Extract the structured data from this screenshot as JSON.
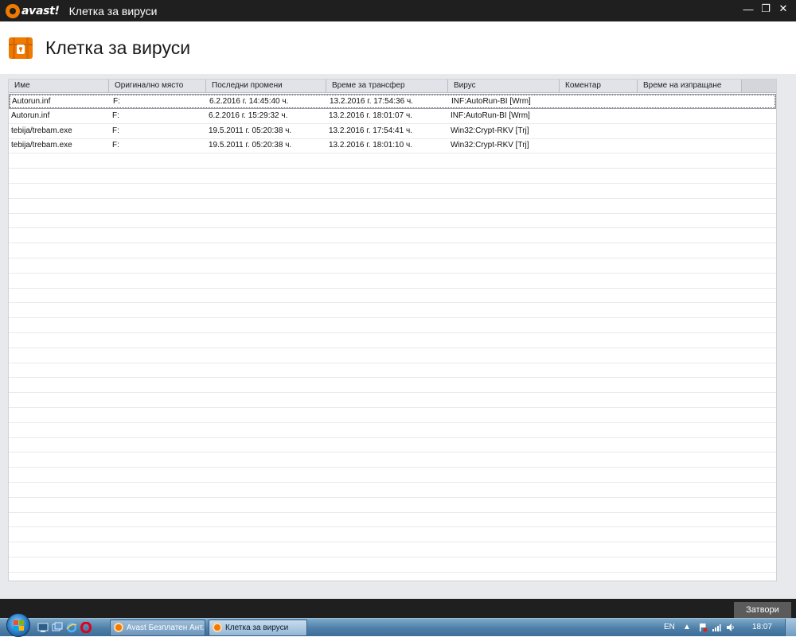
{
  "window": {
    "logo_text": "avast!",
    "title": "Клетка за вируси",
    "controls": {
      "minimize": "—",
      "restore": "❐",
      "close": "✕"
    }
  },
  "header": {
    "title": "Клетка за вируси"
  },
  "table": {
    "columns": [
      "Име",
      "Оригинално място",
      "Последни промени",
      "Време за трансфер",
      "Вирус",
      "Коментар",
      "Време на изпращане"
    ],
    "rows": [
      [
        "Autorun.inf",
        "F:",
        "6.2.2016 г. 14:45:40 ч.",
        "13.2.2016 г. 17:54:36 ч.",
        "INF:AutoRun-BI [Wrm]",
        "",
        ""
      ],
      [
        "Autorun.inf",
        "F:",
        "6.2.2016 г. 15:29:32 ч.",
        "13.2.2016 г. 18:01:07 ч.",
        "INF:AutoRun-BI [Wrm]",
        "",
        ""
      ],
      [
        "tebija/trebam.exe",
        "F:",
        "19.5.2011 г. 05:20:38 ч.",
        "13.2.2016 г. 17:54:41 ч.",
        "Win32:Crypt-RKV [Trj]",
        "",
        ""
      ],
      [
        "tebija/trebam.exe",
        "F:",
        "19.5.2011 г. 05:20:38 ч.",
        "13.2.2016 г. 18:01:10 ч.",
        "Win32:Crypt-RKV [Trj]",
        "",
        ""
      ]
    ],
    "selected_row": 0
  },
  "footer": {
    "close_label": "Затвори"
  },
  "taskbar": {
    "items": [
      {
        "label": "Avast Безплатен Ант...",
        "active": false
      },
      {
        "label": "Клетка за вируси",
        "active": true
      }
    ],
    "tray": {
      "language": "EN",
      "time": "18:07"
    }
  },
  "colors": {
    "accent": "#f07a00",
    "titlebar": "#1f1f1f"
  }
}
